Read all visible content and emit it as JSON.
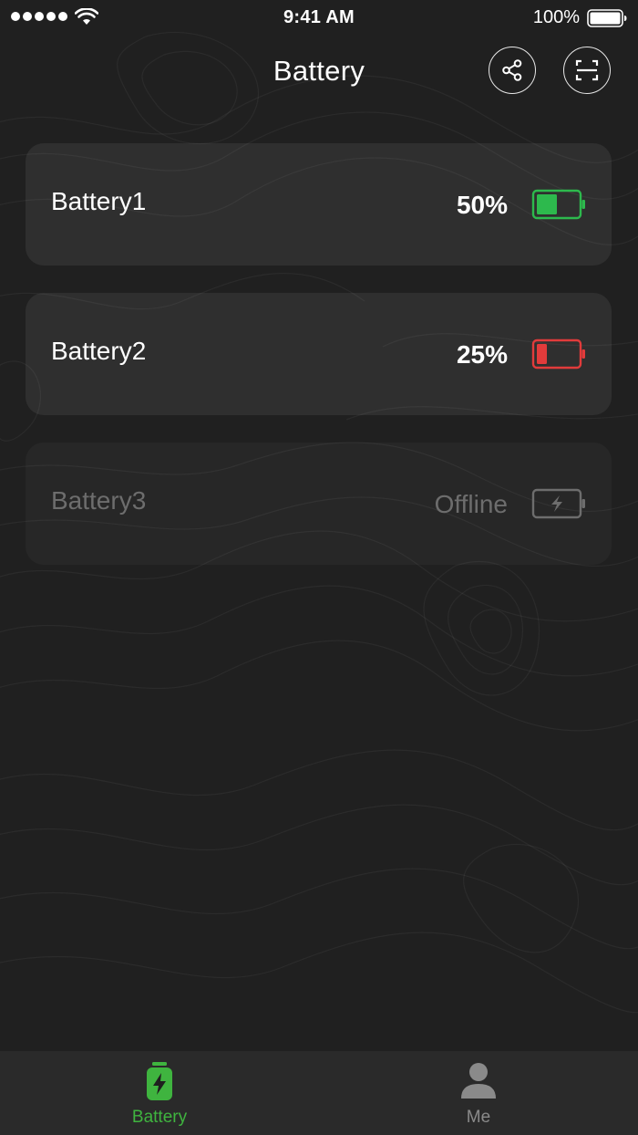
{
  "status_bar": {
    "time": "9:41 AM",
    "battery_percent": "100%"
  },
  "header": {
    "title": "Battery",
    "share_icon": "share-icon",
    "scan_icon": "scan-icon"
  },
  "batteries": [
    {
      "name": "Battery1",
      "status": "50%",
      "level": 0.5,
      "color": "#2db94d",
      "online": true
    },
    {
      "name": "Battery2",
      "status": "25%",
      "level": 0.25,
      "color": "#e23b3b",
      "online": true
    },
    {
      "name": "Battery3",
      "status": "Offline",
      "level": 0,
      "color": "#6d6d6d",
      "online": false
    }
  ],
  "tab_bar": {
    "tabs": [
      {
        "label": "Battery",
        "icon": "battery-charging-icon",
        "active": true,
        "color": "#3fb43f"
      },
      {
        "label": "Me",
        "icon": "person-icon",
        "active": false,
        "color": "#8a8a8a"
      }
    ]
  }
}
